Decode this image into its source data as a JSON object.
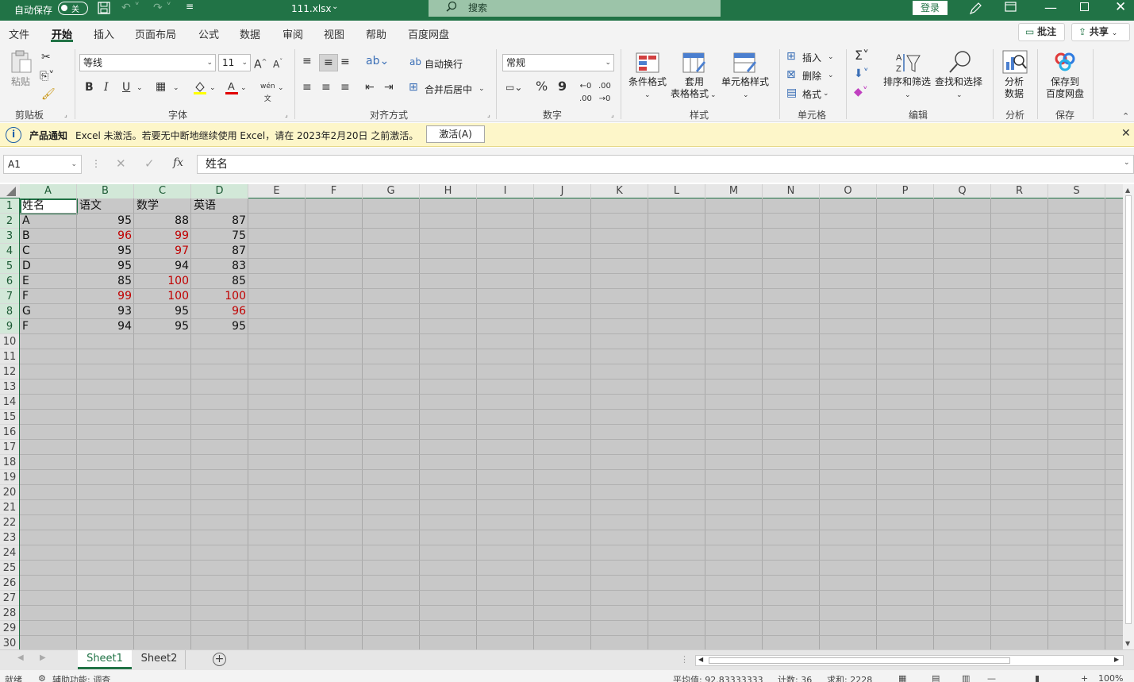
{
  "titlebar": {
    "autosave_label": "自动保存",
    "autosave_state": "关",
    "filename": "111.xlsx",
    "search_placeholder": "搜索",
    "login": "登录"
  },
  "menu": {
    "items": [
      "文件",
      "开始",
      "插入",
      "页面布局",
      "公式",
      "数据",
      "审阅",
      "视图",
      "帮助",
      "百度网盘"
    ],
    "active": "开始",
    "comments": "批注",
    "share": "共享"
  },
  "ribbon": {
    "clipboard": {
      "paste": "粘贴",
      "label": "剪贴板"
    },
    "font": {
      "name": "等线",
      "size": "11",
      "label": "字体",
      "bold": "B",
      "italic": "I",
      "underline": "U"
    },
    "alignment": {
      "wrap": "自动换行",
      "merge": "合并后居中",
      "label": "对齐方式"
    },
    "number": {
      "format": "常规",
      "percent": "%",
      "comma": "9",
      "label": "数字"
    },
    "styles": {
      "conditional": "条件格式",
      "table1": "套用",
      "table2": "表格格式",
      "cell": "单元格样式",
      "label": "样式"
    },
    "cells": {
      "insert": "插入",
      "delete": "删除",
      "format": "格式",
      "label": "单元格"
    },
    "editing": {
      "sort": "排序和筛选",
      "find": "查找和选择",
      "label": "编辑"
    },
    "analysis": {
      "btn1": "分析",
      "btn2": "数据",
      "label": "分析"
    },
    "save": {
      "btn1": "保存到",
      "btn2": "百度网盘",
      "label": "保存"
    }
  },
  "notice": {
    "title": "产品通知",
    "message": "Excel 未激活。若要无中断地继续使用 Excel，请在 2023年2月20日 之前激活。",
    "button": "激活(A)"
  },
  "formula_bar": {
    "name_box": "A1",
    "content": "姓名",
    "fx": "fx"
  },
  "columns": [
    "A",
    "B",
    "C",
    "D",
    "E",
    "F",
    "G",
    "H",
    "I",
    "J",
    "K",
    "L",
    "M",
    "N",
    "O",
    "P",
    "Q",
    "R",
    "S"
  ],
  "rows": [
    "1",
    "2",
    "3",
    "4",
    "5",
    "6",
    "7",
    "8",
    "9",
    "10",
    "11",
    "12",
    "13",
    "14",
    "15",
    "16",
    "17",
    "18",
    "19",
    "20",
    "21",
    "22",
    "23",
    "24",
    "25",
    "26",
    "27",
    "28",
    "29",
    "30"
  ],
  "sheet": {
    "headers": [
      "姓名",
      "语文",
      "数学",
      "英语"
    ],
    "data": [
      {
        "name": "A",
        "v": [
          95,
          88,
          87
        ],
        "red": [
          false,
          false,
          false
        ]
      },
      {
        "name": "B",
        "v": [
          96,
          99,
          75
        ],
        "red": [
          true,
          true,
          false
        ]
      },
      {
        "name": "C",
        "v": [
          95,
          97,
          87
        ],
        "red": [
          false,
          true,
          false
        ]
      },
      {
        "name": "D",
        "v": [
          95,
          94,
          83
        ],
        "red": [
          false,
          false,
          false
        ]
      },
      {
        "name": "E",
        "v": [
          85,
          100,
          85
        ],
        "red": [
          false,
          true,
          false
        ]
      },
      {
        "name": "F",
        "v": [
          99,
          100,
          100
        ],
        "red": [
          true,
          true,
          true
        ]
      },
      {
        "name": "G",
        "v": [
          93,
          95,
          96
        ],
        "red": [
          false,
          false,
          true
        ]
      },
      {
        "name": "F",
        "v": [
          94,
          95,
          95
        ],
        "red": [
          false,
          false,
          false
        ]
      }
    ]
  },
  "tabs": [
    "Sheet1",
    "Sheet2"
  ],
  "active_tab": "Sheet1",
  "status": {
    "ready": "就绪",
    "accessibility": "辅助功能: 调查",
    "average": "平均值: 92.83333333",
    "count": "计数: 36",
    "sum": "求和: 2228",
    "zoom": "100%"
  },
  "colors": {
    "accent": "#217346",
    "red": "#c00000"
  }
}
